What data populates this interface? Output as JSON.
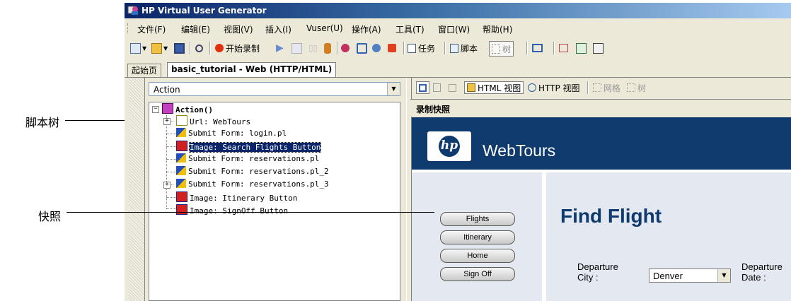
{
  "callouts": {
    "script_tree": "脚本树",
    "snapshot": "快照"
  },
  "window": {
    "title": "HP Virtual User Generator"
  },
  "menu": [
    "文件(F)",
    "编辑(E)",
    "视图(V)",
    "插入(I)",
    "Vuser(U)",
    "操作(A)",
    "工具(T)",
    "窗口(W)",
    "帮助(H)"
  ],
  "toolbar": {
    "record": "开始录制",
    "tasks": "任务",
    "script": "脚本",
    "tree": "树"
  },
  "tabs": [
    {
      "label": "起始页"
    },
    {
      "label": "basic_tutorial - Web (HTTP/HTML)"
    }
  ],
  "action_combo": "Action",
  "tree": {
    "root": "Action()",
    "nodes": [
      "Url: WebTours",
      "Submit Form: login.pl",
      "Image: Search Flights Button",
      "Submit Form: reservations.pl",
      "Submit Form: reservations.pl_2",
      "Submit Form: reservations.pl_3",
      "Image: Itinerary Button",
      "Image: SignOff Button"
    ]
  },
  "view_toolbar": {
    "html_view": "HTML 视图",
    "http_view": "HTTP 视图",
    "grid": "网格",
    "tree": "树"
  },
  "snapshot_header": "录制快照",
  "webtours": {
    "logo": "hp",
    "name": "WebTours",
    "nav": [
      "Flights",
      "Itinerary",
      "Home",
      "Sign Off"
    ],
    "title": "Find Flight",
    "departure_city_label": "Departure City :",
    "departure_city_value": "Denver",
    "departure_date_label": "Departure Date :"
  },
  "colors": {
    "webtours_blue": "#0e3a6e",
    "selection": "#0a246a"
  }
}
